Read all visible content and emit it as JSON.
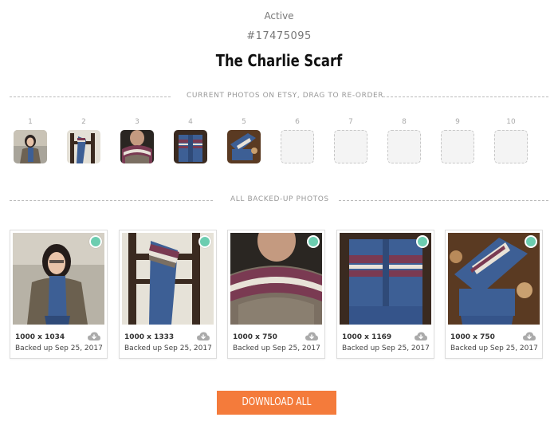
{
  "listing": {
    "status": "Active",
    "id": "#17475095",
    "title": "The Charlie Scarf"
  },
  "current_photos": {
    "heading": "CURRENT PHOTOS ON ETSY, DRAG TO RE-ORDER",
    "slots": [
      {
        "number": "1",
        "filled": true
      },
      {
        "number": "2",
        "filled": true
      },
      {
        "number": "3",
        "filled": true
      },
      {
        "number": "4",
        "filled": true
      },
      {
        "number": "5",
        "filled": true
      },
      {
        "number": "6",
        "filled": false
      },
      {
        "number": "7",
        "filled": false
      },
      {
        "number": "8",
        "filled": false
      },
      {
        "number": "9",
        "filled": false
      },
      {
        "number": "10",
        "filled": false
      }
    ]
  },
  "backed_up_photos": {
    "heading": "ALL BACKED-UP PHOTOS",
    "items": [
      {
        "dimensions": "1000 x 1034",
        "backed_up": "Backed up Sep 25, 2017"
      },
      {
        "dimensions": "1000 x 1333",
        "backed_up": "Backed up Sep 25, 2017"
      },
      {
        "dimensions": "1000 x 750",
        "backed_up": "Backed up Sep 25, 2017"
      },
      {
        "dimensions": "1000 x 1169",
        "backed_up": "Backed up Sep 25, 2017"
      },
      {
        "dimensions": "1000 x 750",
        "backed_up": "Backed up Sep 25, 2017"
      }
    ]
  },
  "actions": {
    "download_all": "DOWNLOAD ALL"
  },
  "colors": {
    "accent": "#f47b3b",
    "check": "#6ccdb0",
    "scarf_blue": "#3d5f95",
    "scarf_maroon": "#7a3a52",
    "scarf_cream": "#e8e2d8"
  }
}
